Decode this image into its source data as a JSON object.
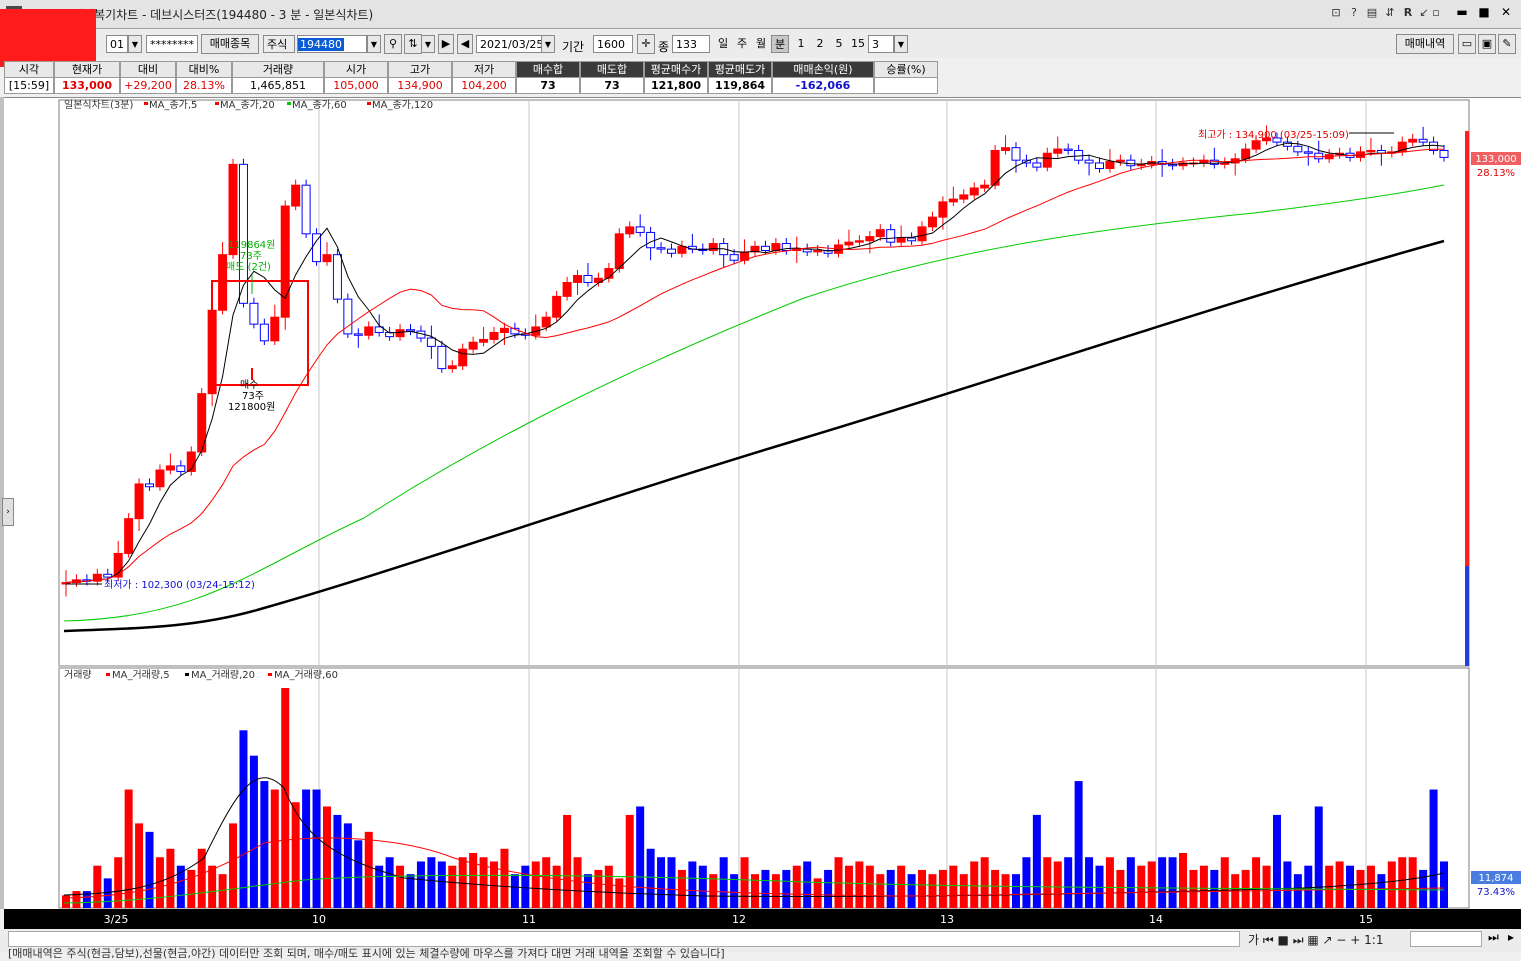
{
  "window": {
    "title": "[2450]매매복기차트 - 데브시스터즈(194480 - 3 분 - 일본식차트)",
    "icons": [
      "restore-icon",
      "help-icon",
      "layout-icon",
      "link-icon",
      "r-icon",
      "pin-icon",
      "minimize-icon",
      "maximize-icon",
      "close-icon"
    ],
    "minimize": "▬",
    "maximize": "■",
    "close": "✕"
  },
  "toolbar": {
    "account_suffix": "01",
    "password": "********",
    "trade_item_button": "매매종목",
    "stock_type": "주식",
    "code": "194480",
    "date": "2021/03/25",
    "period_label": "기간",
    "period_value": "1600",
    "count_label": "종",
    "count_value": "133",
    "periods": [
      "일",
      "주",
      "월",
      "분",
      "1",
      "2",
      "5",
      "15"
    ],
    "selected_period": "분",
    "interval_value": "3",
    "trade_history_button": "매매내역"
  },
  "grid": {
    "headers": [
      "시각",
      "현재가",
      "대비",
      "대비%",
      "거래량",
      "시가",
      "고가",
      "저가",
      "매수합",
      "매도합",
      "평균매수가",
      "평균매도가",
      "매매손익(원)",
      "승률(%)"
    ],
    "values": [
      "[15:59]",
      "133,000",
      "+29,200",
      "28.13%",
      "1,465,851",
      "105,000",
      "134,900",
      "104,200",
      "73",
      "73",
      "121,800",
      "119,864",
      "-162,066",
      ""
    ]
  },
  "price_chart": {
    "legend": [
      "일본식차트(3분)",
      "MA_종가,5",
      "MA_종가,20",
      "MA_종가,60",
      "MA_종가,120"
    ],
    "high_label": "최고가 : 134,900 (03/25-15:09)",
    "low_label": "최저가 : 102,300 (03/24-15:12)",
    "price_tag": "133,000",
    "pct_tag": "28.13%",
    "sell_label_1": "119864원",
    "sell_label_2": "73주",
    "sell_label_3": "매도 (2건)",
    "buy_label_1": "매수",
    "buy_label_2": "73주",
    "buy_label_3": "121800원",
    "colors": {
      "up": "#ff0000",
      "down": "#0000ff",
      "ma5": "#000000",
      "ma20": "#ff0000",
      "ma60": "#00cc00",
      "ma120": "#000000"
    }
  },
  "volume_chart": {
    "legend": [
      "거래량",
      "MA_거래량,5",
      "MA_거래량,20",
      "MA_거래량,60"
    ],
    "volume_tag": "11,874",
    "pct_tag": "73.43%"
  },
  "time_axis": [
    "3/25",
    "10",
    "11",
    "12",
    "13",
    "14",
    "15"
  ],
  "statusbar": {
    "message": "[매매내역은 주식(현금,담보),선물(현금,야간) 데이터만 조회 되며, 매수/매도 표시에 있는 체결수량에 마우스를 가져다 대면 거래 내역을 조회할 수 있습니다]",
    "zoom": "1:1"
  }
}
